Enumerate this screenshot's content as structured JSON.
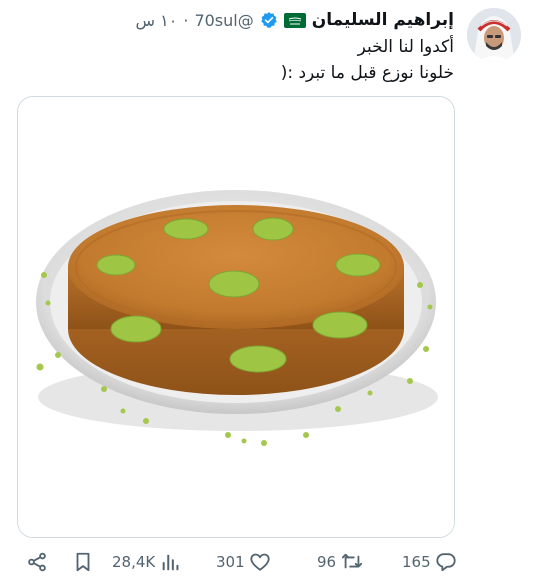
{
  "author": {
    "name": "إبراهيم السليمان",
    "handle": "@70sul",
    "time": "١٠ س",
    "separator": "·",
    "flag_icon": "saudi-flag-icon",
    "verified_icon": "verified-badge-icon"
  },
  "tweet": {
    "lines": [
      "أكدوا لنا الخبر",
      "خلونا نوزع قبل ما تبرد :("
    ]
  },
  "media": {
    "description_icon": "kunafa-photo"
  },
  "actions": {
    "replies": "165",
    "retweets": "96",
    "likes": "301",
    "views": "28,4K"
  },
  "colors": {
    "text": "#0f1419",
    "muted": "#536471",
    "verified": "#1d9bf0",
    "border": "#cfd9de"
  }
}
